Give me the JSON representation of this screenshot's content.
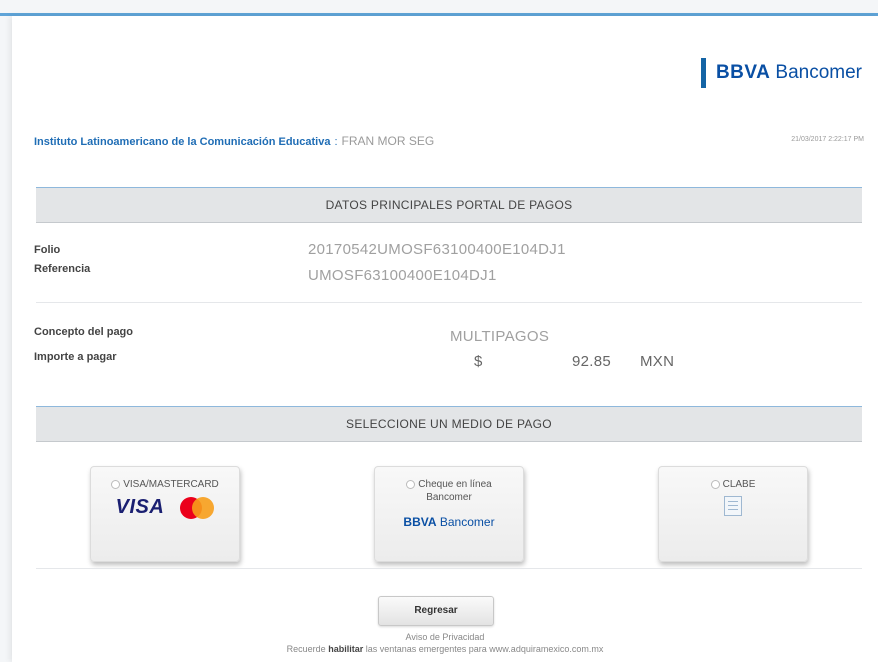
{
  "brand": {
    "logo_bold": "BBVA",
    "logo_rest": "Bancomer"
  },
  "institution": {
    "name": "Instituto Latinoamericano de la Comunicación Educativa",
    "separator": ":",
    "user": "FRAN MOR SEG",
    "datetime": "21/03/2017 2:22:17 PM"
  },
  "main_section": {
    "title": "DATOS PRINCIPALES PORTAL DE PAGOS"
  },
  "folio": {
    "label": "Folio",
    "value": "20170542UMOSF63100400E104DJ1"
  },
  "referencia": {
    "label": "Referencia",
    "value": "UMOSF63100400E104DJ1"
  },
  "concepto": {
    "label": "Concepto del pago",
    "value": "MULTIPAGOS"
  },
  "importe": {
    "label": "Importe a pagar",
    "currency_symbol": "$",
    "amount": "92.85",
    "currency": "MXN"
  },
  "payment_section": {
    "title": "SELECCIONE UN MEDIO DE PAGO"
  },
  "payment_options": [
    {
      "label": "VISA/MASTERCARD",
      "brand_text": "VISA"
    },
    {
      "label_line1": "Cheque en línea",
      "label_line2": "Bancomer",
      "logo_bold": "BBVA",
      "logo_rest": "Bancomer"
    },
    {
      "label": "CLABE"
    }
  ],
  "actions": {
    "back_label": "Regresar"
  },
  "footer": {
    "privacy_link": "Aviso de Privacidad",
    "reminder_prefix": "Recuerde",
    "reminder_bold": "habilitar",
    "reminder_suffix": "las ventanas emergentes para www.adquiramexico.com.mx"
  },
  "colors": {
    "accent": "#5fa4d8",
    "brand": "#094fa4",
    "institution_text": "#1f6db5",
    "section_bg": "#e3e5e7"
  }
}
